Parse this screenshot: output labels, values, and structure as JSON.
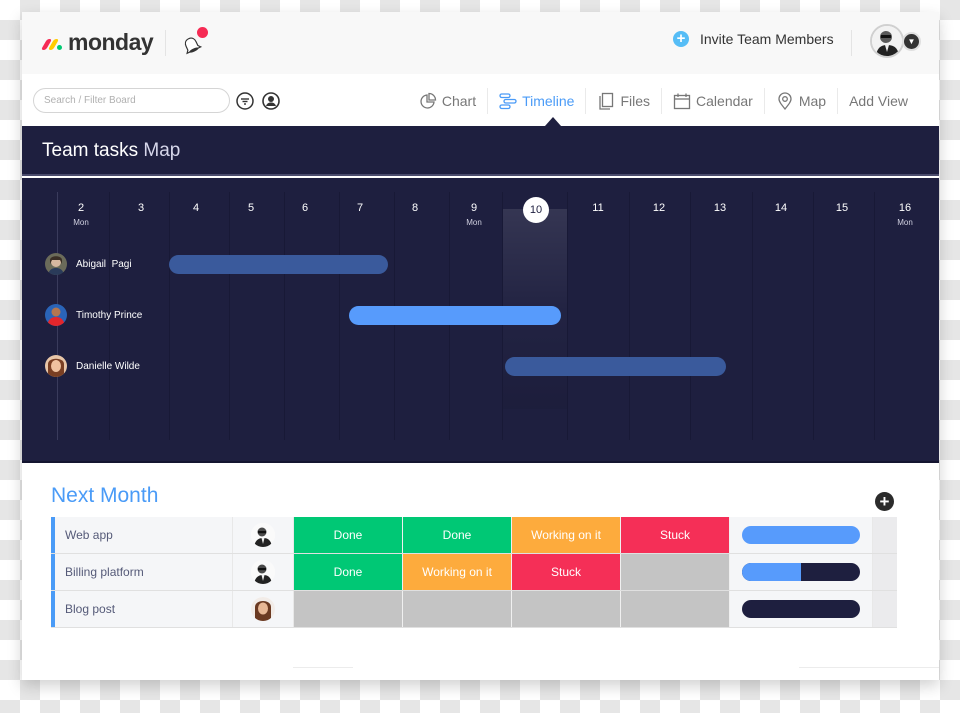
{
  "header": {
    "logo_text": "monday",
    "notifications_icon": "bell-icon",
    "has_unread_notification": true,
    "invite_label": "Invite Team Members",
    "invite_icon": "plus-circle-icon",
    "user_avatar": "user-avatar",
    "user_menu_icon": "caret-down-icon"
  },
  "toolbar": {
    "search_placeholder": "Search / Filter Board",
    "filter_icon": "filter-icon",
    "person_filter_icon": "person-circle-icon",
    "views": [
      {
        "label": "Chart",
        "icon": "pie-chart-icon",
        "active": false
      },
      {
        "label": "Timeline",
        "icon": "timeline-icon",
        "active": true
      },
      {
        "label": "Files",
        "icon": "files-icon",
        "active": false
      },
      {
        "label": "Calendar",
        "icon": "calendar-icon",
        "active": false
      },
      {
        "label": "Map",
        "icon": "map-pin-icon",
        "active": false
      },
      {
        "label": "Add View",
        "icon": "",
        "active": false
      }
    ]
  },
  "board": {
    "title": "Team tasks",
    "view_name": "Map"
  },
  "timeline": {
    "today": "10",
    "days": [
      {
        "day": "2",
        "dow": "Mon"
      },
      {
        "day": "3",
        "dow": ""
      },
      {
        "day": "4",
        "dow": ""
      },
      {
        "day": "5",
        "dow": ""
      },
      {
        "day": "6",
        "dow": ""
      },
      {
        "day": "7",
        "dow": ""
      },
      {
        "day": "8",
        "dow": ""
      },
      {
        "day": "9",
        "dow": "Mon"
      },
      {
        "day": "10",
        "dow": ""
      },
      {
        "day": "11",
        "dow": ""
      },
      {
        "day": "12",
        "dow": ""
      },
      {
        "day": "13",
        "dow": ""
      },
      {
        "day": "14",
        "dow": ""
      },
      {
        "day": "15",
        "dow": ""
      },
      {
        "day": "16",
        "dow": "Mon"
      }
    ],
    "people": [
      {
        "name": "Abigail  Pagi",
        "start_day": 3.5,
        "end_day": 7.5,
        "color": "#3a5a9c"
      },
      {
        "name": "Timothy Prince",
        "start_day": 6.8,
        "end_day": 10.4,
        "color": "#579bfc"
      },
      {
        "name": "Danielle Wilde",
        "start_day": 9.5,
        "end_day": 13.1,
        "color": "#3a5a9c"
      }
    ]
  },
  "group": {
    "title": "Next Month",
    "add_column_icon": "plus-circle-icon",
    "color": "#4a9bf7",
    "rows": [
      {
        "name": "Web app",
        "person": "man-sunglasses",
        "statuses": [
          {
            "label": "Done",
            "color": "#00c875"
          },
          {
            "label": "Done",
            "color": "#00c875"
          },
          {
            "label": "Working on it",
            "color": "#fdab3d"
          },
          {
            "label": "Stuck",
            "color": "#f52f57"
          }
        ],
        "progress": 1.0
      },
      {
        "name": "Billing platform",
        "person": "man-sunglasses",
        "statuses": [
          {
            "label": "Done",
            "color": "#00c875"
          },
          {
            "label": "Working on it",
            "color": "#fdab3d"
          },
          {
            "label": "Stuck",
            "color": "#f52f57"
          },
          {
            "label": "",
            "color": "#c4c4c4"
          }
        ],
        "progress": 0.5
      },
      {
        "name": "Blog post",
        "person": "woman-brown-hair",
        "statuses": [
          {
            "label": "",
            "color": "#c4c4c4"
          },
          {
            "label": "",
            "color": "#c4c4c4"
          },
          {
            "label": "",
            "color": "#c4c4c4"
          },
          {
            "label": "",
            "color": "#c4c4c4"
          }
        ],
        "progress": 0.0
      }
    ]
  },
  "colors": {
    "accent": "#4a9bf7",
    "timeline_bg": "#1e1f3f",
    "done": "#00c875",
    "working": "#fdab3d",
    "stuck": "#f52f57",
    "empty": "#c4c4c4"
  }
}
